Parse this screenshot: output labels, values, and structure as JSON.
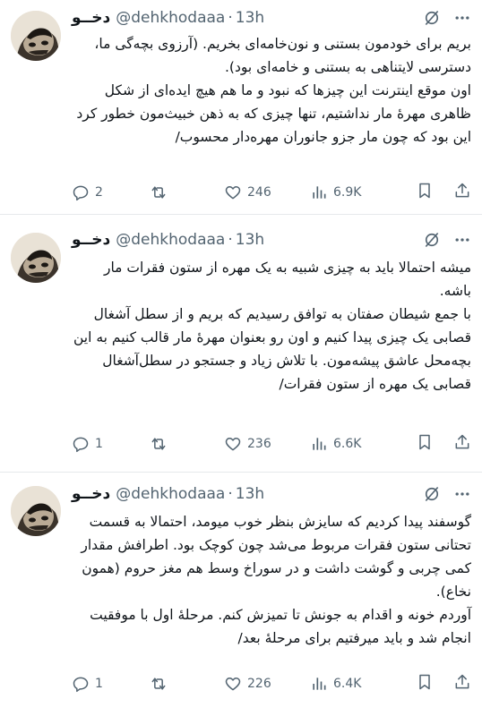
{
  "tweets": [
    {
      "name": "دخــو",
      "handle": "@dehkhodaaa",
      "dot": "·",
      "time": "13h",
      "text": "بریم برای خودمون بستنی و نون‌خامه‌ای بخریم. (آرزوی بچه‌گی ما، دسترسی لایتناهی به بستنی و خامه‌ای بود).\nاون موقع اینترنت این چیزها که نبود و ما هم هیچ ایده‌ای از شکل ظاهری مهرهٔ مار نداشتیم، تنها چیزی که به ذهن خبیث‌مون خطور کرد این بود که چون مار جزو جانوران مهره‌دار محسوب/",
      "replies": "2",
      "retweets": "",
      "likes": "246",
      "views": "6.9K"
    },
    {
      "name": "دخــو",
      "handle": "@dehkhodaaa",
      "dot": "·",
      "time": "13h",
      "text": "میشه احتمالا باید به چیزی شبیه به یک مهره از ستون فقرات مار باشه.\nبا جمع شیطان صفتان به توافق رسیدیم که بریم و از سطل آشغال قصابی یک چیزی پیدا کنیم و اون رو بعنوان مهرهٔ مار قالب کنیم به این بچه‌محل عاشق پیشه‌مون. با تلاش زیاد و جستجو در سطل‌آشغال قصابی یک مهره از ستون فقرات/",
      "replies": "1",
      "retweets": "",
      "likes": "236",
      "views": "6.6K"
    },
    {
      "name": "دخــو",
      "handle": "@dehkhodaaa",
      "dot": "·",
      "time": "13h",
      "text": "گوسفند پیدا کردیم که سایزش بنظر خوب میومد، احتمالا به قسمت تحتانی ستون فقرات مربوط می‌شد چون کوچک بود. اطرافش مقدار کمی چربی و گوشت داشت و در سوراخ وسط هم مغز حروم (همون نخاع).\nآوردم خونه و اقدام به جونش تا تمیزش کنم. مرحلهٔ اول با موفقیت انجام شد و باید میرفتیم برای مرحلهٔ بعد/",
      "replies": "1",
      "retweets": "",
      "likes": "226",
      "views": "6.4K"
    }
  ]
}
